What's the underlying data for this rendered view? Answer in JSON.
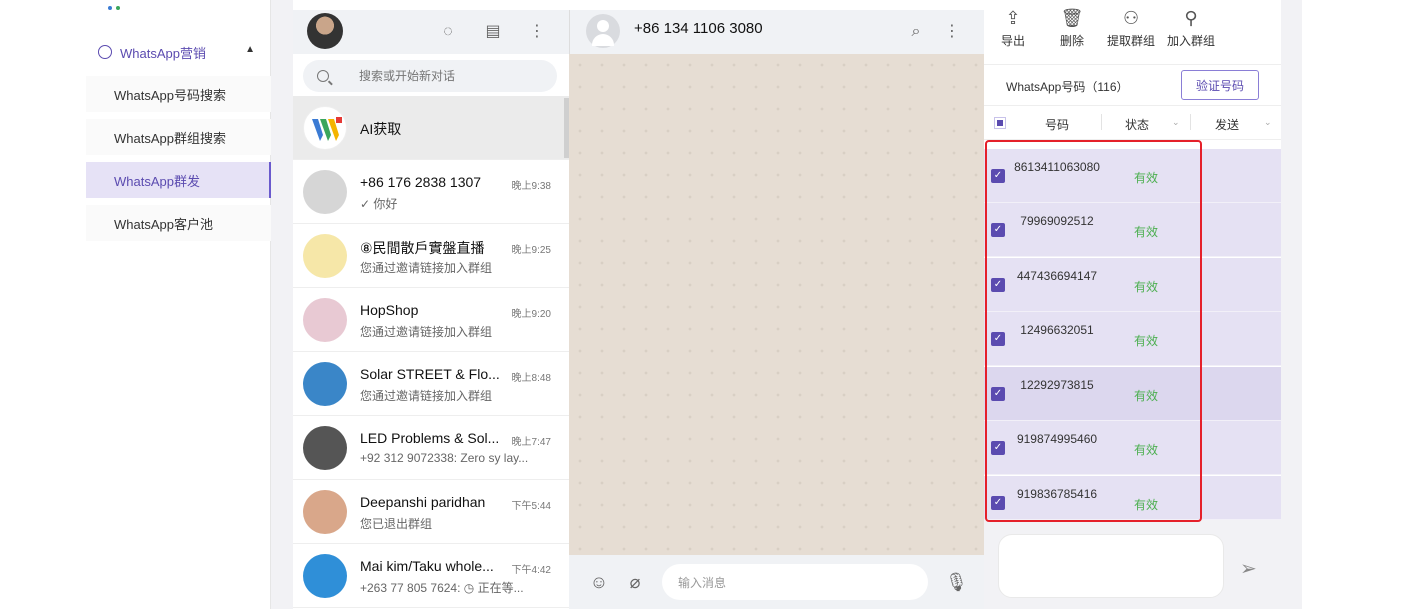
{
  "nav": {
    "group_label": "WhatsApp营销",
    "items": [
      {
        "label": "WhatsApp号码搜索",
        "active": false
      },
      {
        "label": "WhatsApp群组搜索",
        "active": false
      },
      {
        "label": "WhatsApp群发",
        "active": true
      },
      {
        "label": "WhatsApp客户池",
        "active": false
      }
    ]
  },
  "chat_list": {
    "search_placeholder": "搜索或开始新对话",
    "ai_label": "AI获取",
    "chats": [
      {
        "name": "+86 176 2838 1307",
        "time": "晚上9:38",
        "message": "✓ 你好"
      },
      {
        "name": "⑧民間散戶實盤直播",
        "time": "晚上9:25",
        "message": "您通过邀请链接加入群组"
      },
      {
        "name": "HopShop",
        "time": "晚上9:20",
        "message": "您通过邀请链接加入群组"
      },
      {
        "name": "Solar STREET & Flo...",
        "time": "晚上8:48",
        "message": "您通过邀请链接加入群组"
      },
      {
        "name": "LED Problems & Sol...",
        "time": "晚上7:47",
        "message": "+92 312 9072338: Zero sy lay..."
      },
      {
        "name": "Deepanshi paridhan",
        "time": "下午5:44",
        "message": "您已退出群组"
      },
      {
        "name": "Mai kim/Taku whole...",
        "time": "下午4:42",
        "message": "+263 77 805 7624: ◷ 正在等..."
      }
    ]
  },
  "chat": {
    "title": "+86 134 1106 3080",
    "input_placeholder": "输入消息"
  },
  "right_panel": {
    "tools": [
      {
        "label": "导出",
        "icon": "export-icon"
      },
      {
        "label": "删除",
        "icon": "trash-icon"
      },
      {
        "label": "提取群组",
        "icon": "user-icon"
      },
      {
        "label": "加入群组",
        "icon": "user-search-icon"
      }
    ],
    "count_label": "WhatsApp号码（116）",
    "verify_button": "验证号码",
    "columns": [
      "号码",
      "状态",
      "发送"
    ],
    "rows": [
      {
        "number": "8613411063080",
        "status": "有效"
      },
      {
        "number": "79969092512",
        "status": "有效"
      },
      {
        "number": "447436694147",
        "status": "有效"
      },
      {
        "number": "12496632051",
        "status": "有效"
      },
      {
        "number": "12292973815",
        "status": "有效"
      },
      {
        "number": "919874995460",
        "status": "有效"
      },
      {
        "number": "919836785416",
        "status": "有效"
      }
    ]
  },
  "colors": {
    "accent": "#5b4bb0",
    "valid": "#4caf50",
    "highlight": "#e5202a"
  }
}
